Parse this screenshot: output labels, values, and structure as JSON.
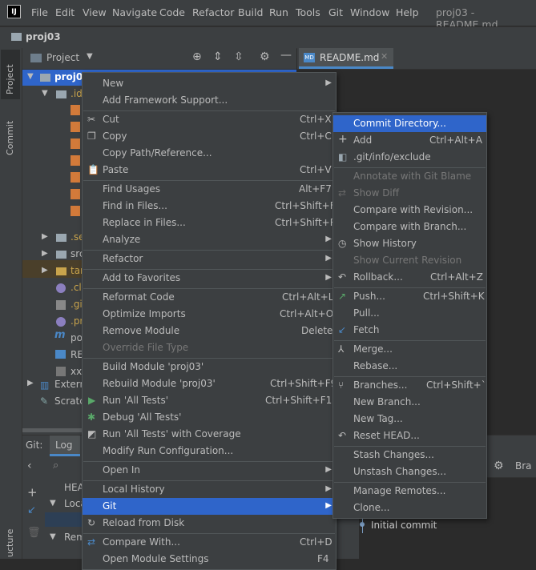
{
  "menubar": {
    "logo": "IJ",
    "items": [
      "File",
      "Edit",
      "View",
      "Navigate",
      "Code",
      "Refactor",
      "Build",
      "Run",
      "Tools",
      "Git",
      "Window",
      "Help"
    ],
    "window_title": "proj03 - README.md"
  },
  "breadcrumb": {
    "project": "proj03"
  },
  "side_tabs": {
    "project": "Project",
    "commit": "Commit",
    "structure": "ucture"
  },
  "project_panel": {
    "title": "Project"
  },
  "editor": {
    "tab_label": "README.md"
  },
  "tree": {
    "root": "proj03",
    "items": [
      ".ide",
      ".se",
      "src",
      "tar",
      ".cla",
      ".git",
      ".pr",
      "po",
      "REA",
      "xxx",
      "Extern",
      "Scratc"
    ]
  },
  "git_panel": {
    "tab_git": "Git:",
    "tab_log": "Log",
    "head": "HEA",
    "local": "Loca",
    "remote": "Rem",
    "branches_col": "Bra",
    "commit": "Initial commit"
  },
  "context_menu": {
    "items": [
      {
        "label": "New",
        "arrow": true
      },
      {
        "label": "Add Framework Support..."
      },
      {
        "label": "Cut",
        "shortcut": "Ctrl+X",
        "icon": "cut-icon"
      },
      {
        "label": "Copy",
        "shortcut": "Ctrl+C",
        "icon": "copy-icon"
      },
      {
        "label": "Copy Path/Reference..."
      },
      {
        "label": "Paste",
        "shortcut": "Ctrl+V",
        "icon": "paste-icon"
      },
      {
        "label": "Find Usages",
        "shortcut": "Alt+F7"
      },
      {
        "label": "Find in Files...",
        "shortcut": "Ctrl+Shift+F"
      },
      {
        "label": "Replace in Files...",
        "shortcut": "Ctrl+Shift+R"
      },
      {
        "label": "Analyze",
        "arrow": true
      },
      {
        "label": "Refactor",
        "arrow": true
      },
      {
        "label": "Add to Favorites",
        "arrow": true
      },
      {
        "label": "Reformat Code",
        "shortcut": "Ctrl+Alt+L"
      },
      {
        "label": "Optimize Imports",
        "shortcut": "Ctrl+Alt+O"
      },
      {
        "label": "Remove Module",
        "shortcut": "Delete"
      },
      {
        "label": "Override File Type",
        "disabled": true
      },
      {
        "label": "Build Module 'proj03'"
      },
      {
        "label": "Rebuild Module 'proj03'",
        "shortcut": "Ctrl+Shift+F9"
      },
      {
        "label": "Run 'All Tests'",
        "shortcut": "Ctrl+Shift+F10",
        "icon": "run-icon"
      },
      {
        "label": "Debug 'All Tests'",
        "icon": "debug-icon"
      },
      {
        "label": "Run 'All Tests' with Coverage",
        "icon": "coverage-icon"
      },
      {
        "label": "Modify Run Configuration..."
      },
      {
        "label": "Open In",
        "arrow": true
      },
      {
        "label": "Local History",
        "arrow": true
      },
      {
        "label": "Git",
        "arrow": true,
        "selected": true
      },
      {
        "label": "Reload from Disk",
        "icon": "reload-icon"
      },
      {
        "label": "Compare With...",
        "shortcut": "Ctrl+D",
        "icon": "compare-icon"
      },
      {
        "label": "Open Module Settings",
        "shortcut": "F4"
      }
    ]
  },
  "git_submenu": {
    "items": [
      {
        "label": "Commit Directory...",
        "selected": true
      },
      {
        "label": "Add",
        "shortcut": "Ctrl+Alt+A",
        "icon": "add-icon"
      },
      {
        "label": ".git/info/exclude",
        "icon": "git-icon"
      },
      {
        "label": "Annotate with Git Blame",
        "disabled": true
      },
      {
        "label": "Show Diff",
        "disabled": true,
        "icon": "diff-icon"
      },
      {
        "label": "Compare with Revision..."
      },
      {
        "label": "Compare with Branch..."
      },
      {
        "label": "Show History",
        "icon": "history-icon"
      },
      {
        "label": "Show Current Revision",
        "disabled": true
      },
      {
        "label": "Rollback...",
        "shortcut": "Ctrl+Alt+Z",
        "icon": "rollback-icon"
      },
      {
        "label": "Push...",
        "shortcut": "Ctrl+Shift+K",
        "icon": "push-icon"
      },
      {
        "label": "Pull..."
      },
      {
        "label": "Fetch",
        "icon": "fetch-icon"
      },
      {
        "label": "Merge...",
        "icon": "merge-icon"
      },
      {
        "label": "Rebase..."
      },
      {
        "label": "Branches...",
        "shortcut": "Ctrl+Shift+`",
        "icon": "branch-icon"
      },
      {
        "label": "New Branch..."
      },
      {
        "label": "New Tag..."
      },
      {
        "label": "Reset HEAD...",
        "icon": "reset-icon"
      },
      {
        "label": "Stash Changes..."
      },
      {
        "label": "Unstash Changes..."
      },
      {
        "label": "Manage Remotes..."
      },
      {
        "label": "Clone..."
      }
    ]
  }
}
